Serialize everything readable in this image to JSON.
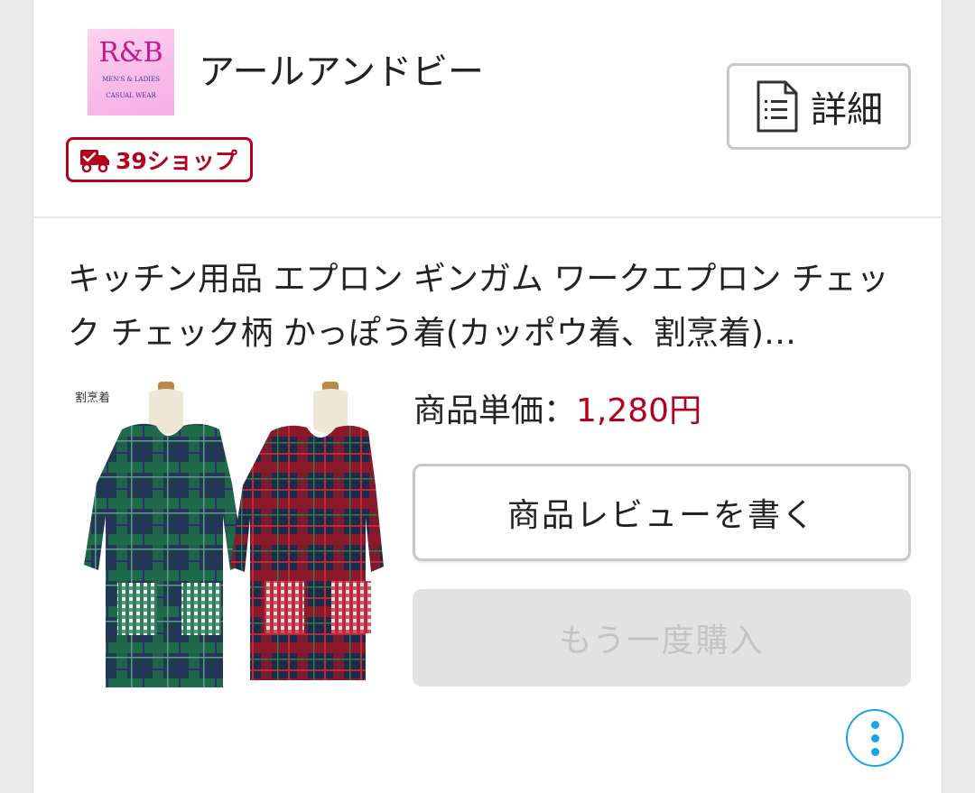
{
  "shop": {
    "logo_text": "R&B",
    "logo_subtext_1": "MEN'S & LADIES",
    "logo_subtext_2": "CASUAL WEAR",
    "name": "アールアンドビー",
    "badge_label": "39ショップ",
    "detail_label": "詳細"
  },
  "product": {
    "title": "キッチン用品 エプロン ギンガム ワークエプロン チェック チェック柄 かっぽう着(カッポウ着、割烹着)…",
    "image_caption": "割烹着",
    "price_label": "商品単価：",
    "price_value": "1,280円",
    "review_button_label": "商品レビューを書く",
    "rebuy_button_label": "もう一度購入"
  },
  "colors": {
    "accent_red": "#b4001e",
    "more_blue": "#1aa3e8",
    "disabled_bg": "#e2e2e2"
  },
  "icons": {
    "badge": "delivery-truck-check-icon",
    "detail": "document-list-icon",
    "more": "vertical-dots-icon"
  }
}
